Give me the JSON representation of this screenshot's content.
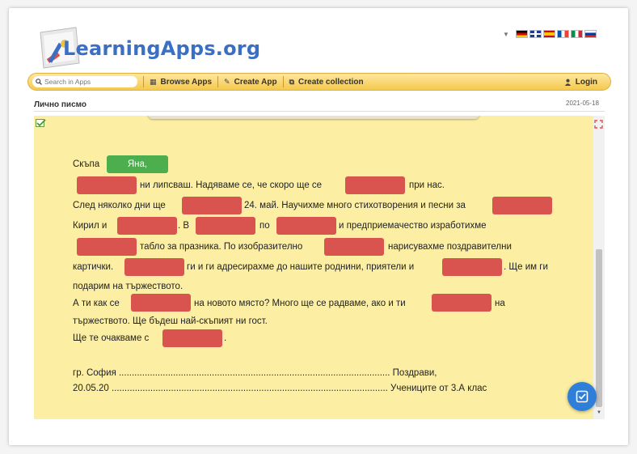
{
  "header": {
    "logo_text": "LearningApps.org",
    "languages": [
      "de",
      "en",
      "es",
      "fr",
      "it",
      "ru"
    ]
  },
  "navbar": {
    "search_placeholder": "Search in Apps",
    "browse_label": "Browse Apps",
    "create_label": "Create App",
    "collection_label": "Create collection",
    "login_label": "Login"
  },
  "app": {
    "title": "Лично писмо",
    "date": "2021-05-18",
    "filled_answer": "Яна,",
    "lines": [
      {
        "id": "l1",
        "segments": [
          "Скъпа"
        ]
      },
      {
        "id": "l2",
        "segments": [
          "ни липсваш. Надяваме се, че скоро ще се",
          "при нас."
        ]
      },
      {
        "id": "l3",
        "segments": [
          "След няколко дни ще",
          "24. май. Научихме много стихотворения и песни за"
        ]
      },
      {
        "id": "l4",
        "segments": [
          "Кирил и",
          ". В",
          "по",
          "и предприемачество изработихме"
        ]
      },
      {
        "id": "l5",
        "segments": [
          "табло за празника. По изобразително",
          "нарисувахме поздравителни"
        ]
      },
      {
        "id": "l6",
        "segments": [
          "картички.",
          "ги и ги адресирахме до нашите роднини, приятели и",
          ". Ще им ги"
        ]
      },
      {
        "id": "l7",
        "segments": [
          "подарим на тържеството."
        ]
      },
      {
        "id": "l8",
        "segments": [
          "А ти как се",
          "на новото място? Много ще се радваме, ако и ти",
          "на"
        ]
      },
      {
        "id": "l9",
        "segments": [
          "тържеството. Ще бъдеш най-скъпият ни гост."
        ]
      },
      {
        "id": "l10",
        "segments": [
          "Ще те очакваме с",
          "."
        ]
      },
      {
        "id": "l11",
        "segments": [
          "гр. София ......................................................................................................... Поздрави,"
        ]
      },
      {
        "id": "l12",
        "segments": [
          "20.05.20 ........................................................................................................... Учениците от 3.А клас"
        ]
      }
    ],
    "blank_count": 15
  },
  "colors": {
    "stage_bg": "#fcefa3",
    "gap_red": "#d9534f",
    "answer_green": "#4cae4c",
    "nav_gold": "#f5c94e",
    "check_blue": "#2f7fd8"
  }
}
